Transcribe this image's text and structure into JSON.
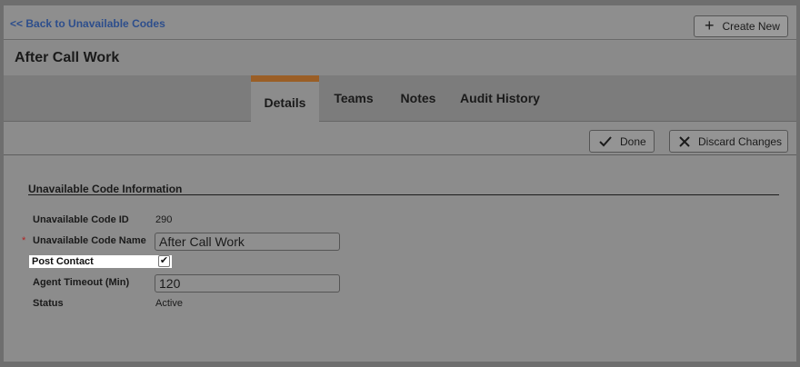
{
  "topbar": {
    "back_label": "<< Back to Unavailable Codes",
    "create_new_label": "Create New"
  },
  "page": {
    "title": "After Call Work"
  },
  "tabs": [
    {
      "label": "Details",
      "active": true
    },
    {
      "label": "Teams",
      "active": false
    },
    {
      "label": "Notes",
      "active": false
    },
    {
      "label": "Audit History",
      "active": false
    }
  ],
  "actions": {
    "done_label": "Done",
    "discard_label": "Discard Changes"
  },
  "form": {
    "section_title": "Unavailable Code Information",
    "code_id": {
      "label": "Unavailable Code ID",
      "value": "290"
    },
    "code_name": {
      "label": "Unavailable Code Name",
      "value": "After Call Work",
      "required_mark": "*"
    },
    "post_contact": {
      "label": "Post Contact",
      "checked": true,
      "check_glyph": "✔"
    },
    "agent_timeout": {
      "label": "Agent Timeout (Min)",
      "value": "120"
    },
    "status": {
      "label": "Status",
      "value": "Active"
    }
  },
  "colors": {
    "link": "#2d4e8c",
    "active_tab_accent": "#9a5e26",
    "required": "#b12424"
  },
  "icons": {
    "create": "plus-icon",
    "done": "checkmark-icon",
    "discard": "x-icon"
  }
}
